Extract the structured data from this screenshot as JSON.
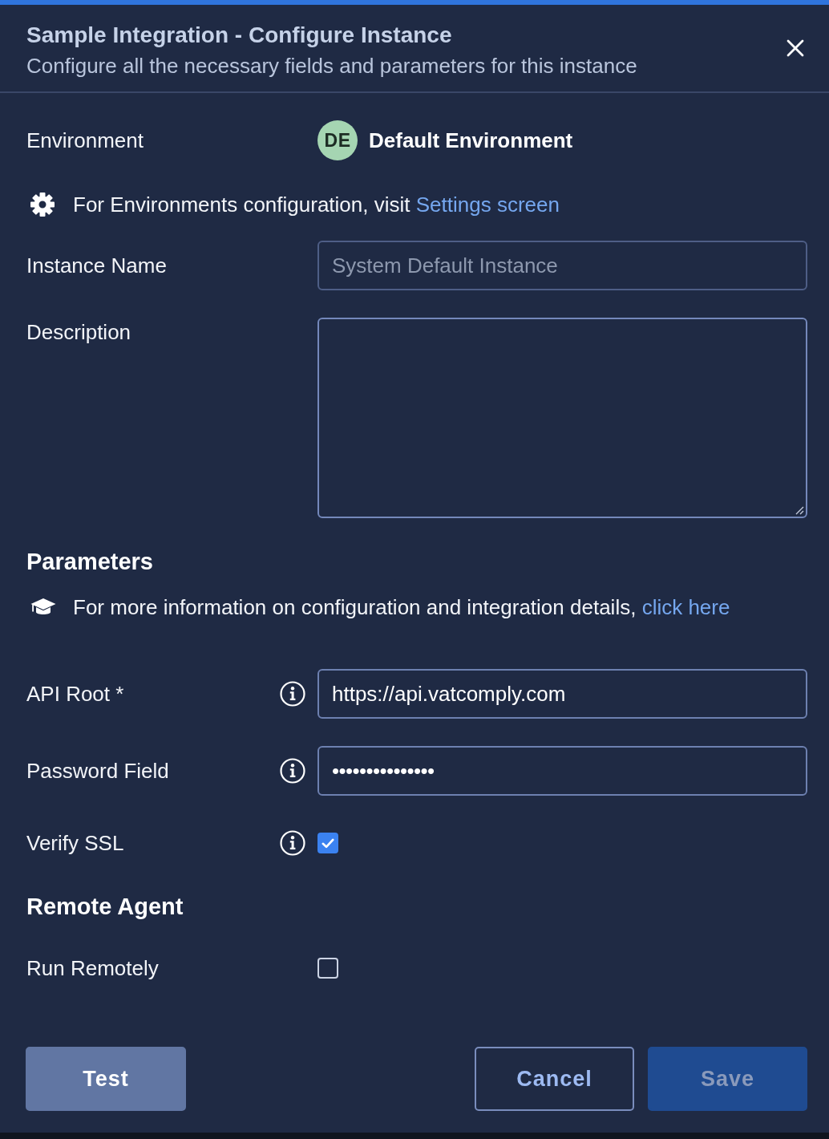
{
  "dialog": {
    "title": "Sample Integration - Configure Instance",
    "subtitle": "Configure all the necessary fields and parameters for this instance"
  },
  "environment": {
    "label": "Environment",
    "avatar": "DE",
    "name": "Default Environment"
  },
  "settings_note": {
    "text": "For Environments configuration, visit",
    "link": "Settings screen"
  },
  "fields": [
    {
      "kind": "text",
      "label": "Instance Name",
      "placeholder": "System Default Instance"
    },
    {
      "kind": "textarea",
      "label": "Description"
    }
  ],
  "parameters": {
    "heading": "Parameters",
    "note": {
      "text": "For more information on configuration and integration details,",
      "link": "click here"
    },
    "fields": [
      {
        "kind": "text",
        "label": "API Root *",
        "value": "https://api.vatcomply.com"
      },
      {
        "kind": "password",
        "label": "Password Field",
        "value": "•••••••••••••••"
      },
      {
        "kind": "checkbox",
        "label": "Verify SSL",
        "checked": true
      }
    ]
  },
  "remote_agent": {
    "heading": "Remote Agent",
    "fields": [
      {
        "kind": "checkbox",
        "label": "Run Remotely",
        "checked": false
      }
    ]
  },
  "buttons": [
    {
      "label": "Test",
      "kind": "secondary",
      "disabled": false
    },
    {
      "label": "Cancel",
      "kind": "outline",
      "disabled": false
    },
    {
      "label": "Save",
      "kind": "primary",
      "disabled": true
    }
  ]
}
